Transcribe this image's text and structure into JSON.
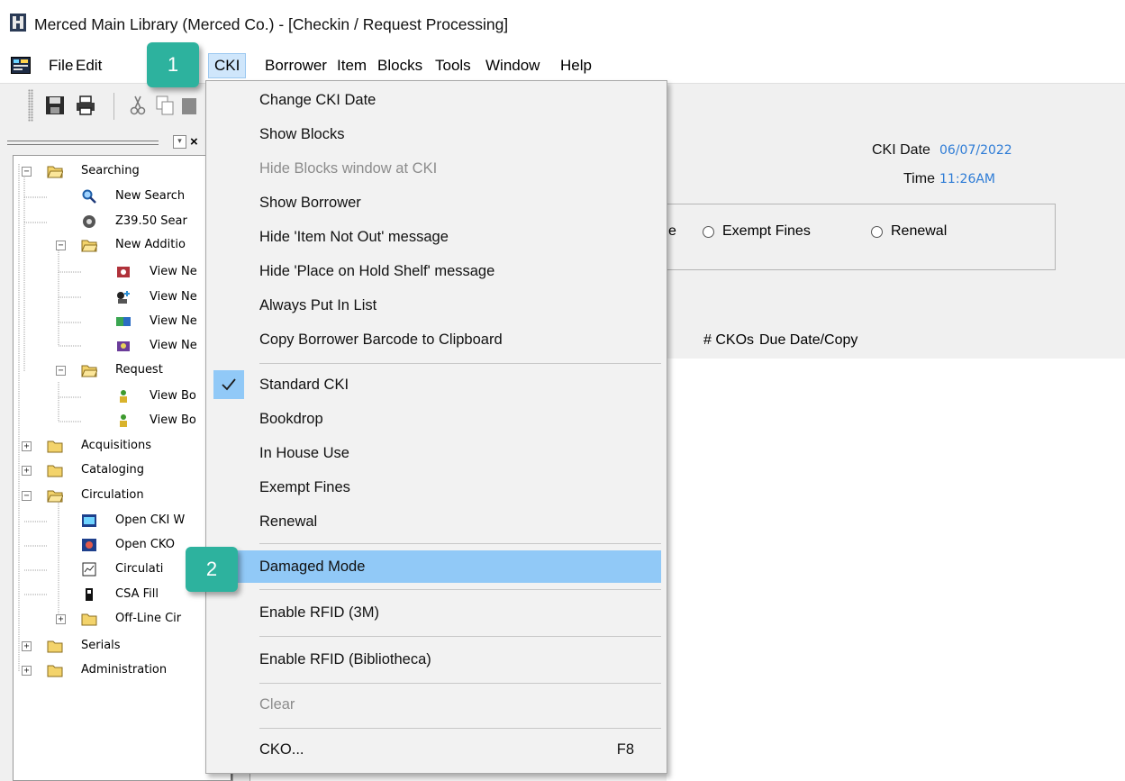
{
  "window": {
    "title": "Merced Main Library (Merced Co.) - [Checkin / Request Processing]",
    "icon": "app-window-icon"
  },
  "menubar": {
    "items": [
      "File",
      "Edit",
      "CKI",
      "Borrower",
      "Item",
      "Blocks",
      "Tools",
      "Window",
      "Help"
    ],
    "active": "CKI"
  },
  "toolbar": {
    "buttons": [
      "save-icon",
      "print-icon",
      "cut-icon",
      "copy-icon",
      "paste-icon"
    ]
  },
  "tree": {
    "nodes": [
      {
        "label": "Searching",
        "icon": "folder-open-icon",
        "expander": "−"
      },
      {
        "label": "New Search",
        "icon": "search-icon"
      },
      {
        "label": "Z39.50 Sear",
        "icon": "z3950-icon"
      },
      {
        "label": "New Additio",
        "icon": "folder-open-icon",
        "expander": "−"
      },
      {
        "label": "View Ne",
        "icon": "view-new-icon"
      },
      {
        "label": "View Ne",
        "icon": "view-new-icon"
      },
      {
        "label": "View Ne",
        "icon": "view-new-icon"
      },
      {
        "label": "View Ne",
        "icon": "view-new-icon"
      },
      {
        "label": "Request",
        "icon": "folder-open-icon",
        "expander": "−"
      },
      {
        "label": "View Bo",
        "icon": "person-icon"
      },
      {
        "label": "View Bo",
        "icon": "person-icon"
      },
      {
        "label": "Acquisitions",
        "icon": "folder-icon",
        "expander": "+"
      },
      {
        "label": "Cataloging",
        "icon": "folder-icon",
        "expander": "+"
      },
      {
        "label": "Circulation",
        "icon": "folder-open-icon",
        "expander": "−"
      },
      {
        "label": "Open CKI W",
        "icon": "cki-window-icon"
      },
      {
        "label": "Open CKO",
        "icon": "cko-icon"
      },
      {
        "label": "Circulati",
        "icon": "circulation-icon"
      },
      {
        "label": "CSA Fill",
        "icon": "csa-fill-icon"
      },
      {
        "label": "Off-Line Cir",
        "icon": "folder-icon",
        "expander": "+"
      },
      {
        "label": "Serials",
        "icon": "folder-icon",
        "expander": "+"
      },
      {
        "label": "Administration",
        "icon": "folder-icon",
        "expander": "+"
      }
    ]
  },
  "checkin": {
    "date_label": "CKI Date",
    "date_value": "06/07/2022",
    "time_label": "Time",
    "time_value": "11:26AM",
    "modes": [
      "e",
      "Exempt Fines",
      "Renewal"
    ],
    "columns": [
      "# CKOs",
      "Due Date/Copy"
    ]
  },
  "cki_menu": {
    "items": [
      {
        "label": "Change CKI Date"
      },
      {
        "label": "Show Blocks"
      },
      {
        "label": "Hide Blocks window at CKI",
        "disabled": true
      },
      {
        "label": "Show Borrower"
      },
      {
        "label": "Hide 'Item Not Out' message"
      },
      {
        "label": "Hide 'Place on Hold Shelf' message"
      },
      {
        "label": "Always Put In List"
      },
      {
        "label": "Copy Borrower Barcode to Clipboard"
      },
      {
        "label": "Standard CKI",
        "checked": true
      },
      {
        "label": "Bookdrop"
      },
      {
        "label": "In House Use"
      },
      {
        "label": "Exempt Fines"
      },
      {
        "label": "Renewal"
      },
      {
        "label": "Damaged Mode",
        "highlighted": true
      },
      {
        "label": "Enable RFID (3M)"
      },
      {
        "label": "Enable RFID (Bibliotheca)"
      },
      {
        "label": "Clear",
        "disabled": true
      },
      {
        "label": "CKO...",
        "shortcut": "F8"
      }
    ]
  },
  "callouts": [
    "1",
    "2"
  ],
  "colors": {
    "callout": "#2db29e",
    "menu_highlight": "#91c9f7",
    "value_text": "#2e7cd6"
  }
}
